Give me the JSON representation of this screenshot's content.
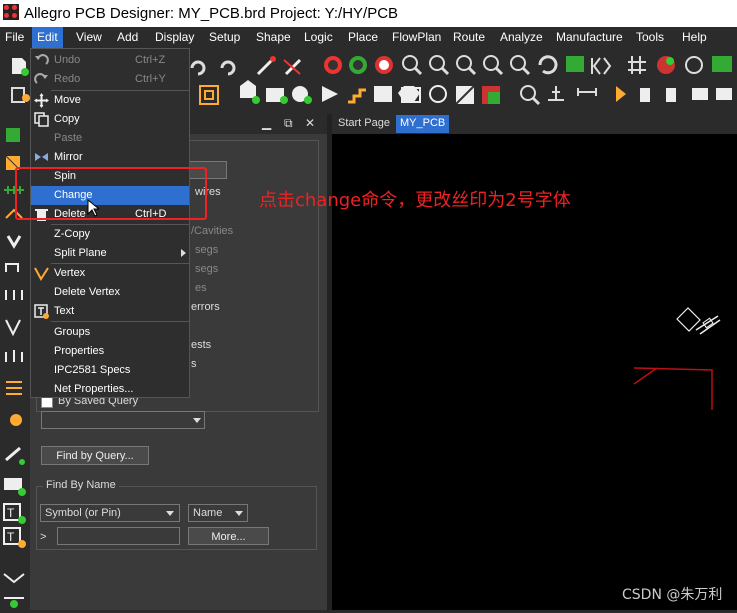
{
  "window": {
    "title": "Allegro PCB Designer: MY_PCB.brd  Project: Y:/HY/PCB"
  },
  "menubar": {
    "items": [
      "File",
      "Edit",
      "View",
      "Add",
      "Display",
      "Setup",
      "Shape",
      "Logic",
      "Place",
      "FlowPlan",
      "Route",
      "Analyze",
      "Manufacture",
      "Tools",
      "Help"
    ],
    "active": "Edit"
  },
  "edit_menu": {
    "undo": {
      "label": "Undo",
      "shortcut": "Ctrl+Z"
    },
    "redo": {
      "label": "Redo",
      "shortcut": "Ctrl+Y"
    },
    "move": "Move",
    "copy": "Copy",
    "paste": "Paste",
    "mirror": "Mirror",
    "spin": "Spin",
    "change": "Change",
    "delete": {
      "label": "Delete",
      "shortcut": "Ctrl+D"
    },
    "zcopy": "Z-Copy",
    "split_plane": "Split Plane",
    "vertex": "Vertex",
    "delete_vertex": "Delete Vertex",
    "text": "Text",
    "groups": "Groups",
    "properties": "Properties",
    "ipc2581": "IPC2581 Specs",
    "net_properties": "Net Properties..."
  },
  "panel": {
    "partial": [
      "wires",
      "/Cavities",
      "segs",
      "segs",
      "es",
      "errors",
      "ests",
      "s"
    ],
    "by_saved_query": "By Saved Query",
    "find_by_query": "Find by Query...",
    "find_by_name_legend": "Find By Name",
    "symbol_select": "Symbol (or Pin)",
    "name_select": "Name",
    "prompt": ">",
    "more": "More..."
  },
  "canvas_tabs": {
    "start": "Start Page",
    "active": "MY_PCB"
  },
  "annotation": "点击change命令，更改丝印为2号字体",
  "watermark": "CSDN @朱万利",
  "colors": {
    "accent": "#2f6fd0",
    "highlight_box": "#e22222",
    "background": "#2b2b2b",
    "canvas": "#000000"
  }
}
